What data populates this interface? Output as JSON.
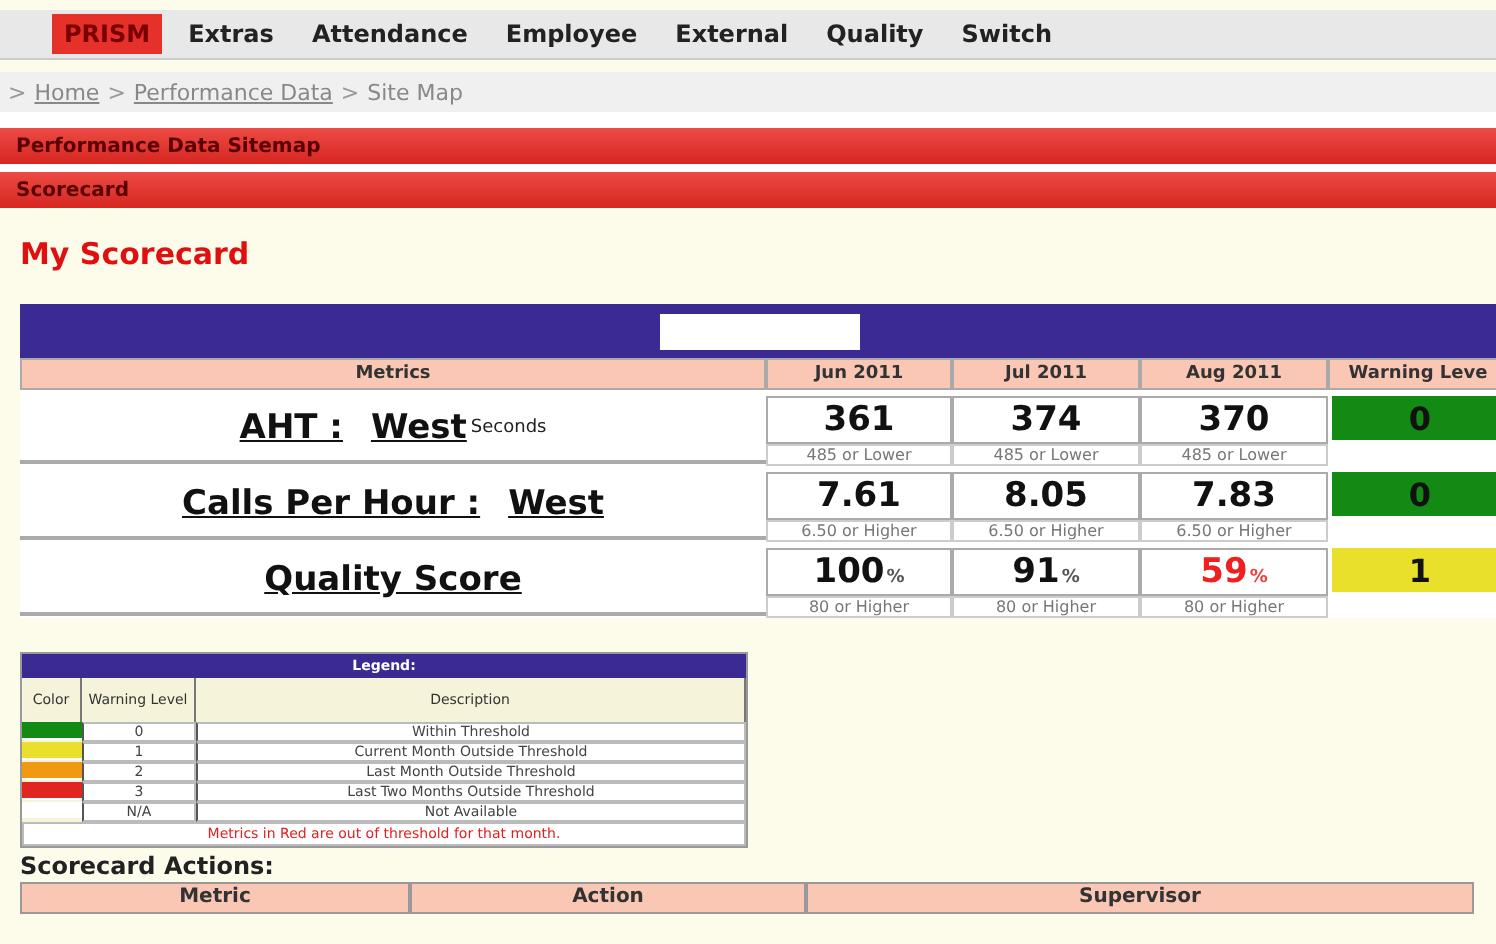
{
  "menu": [
    {
      "label": "PRISM",
      "selected": true
    },
    {
      "label": "Extras",
      "selected": false
    },
    {
      "label": "Attendance",
      "selected": false
    },
    {
      "label": "Employee",
      "selected": false
    },
    {
      "label": "External",
      "selected": false
    },
    {
      "label": "Quality",
      "selected": false
    },
    {
      "label": "Switch",
      "selected": false
    }
  ],
  "breadcrumb": [
    {
      "separator": ">",
      "label": "Home",
      "kind": "link"
    },
    {
      "separator": ">",
      "label": "Performance Data",
      "kind": "link"
    },
    {
      "separator": ">",
      "label": "Site Map",
      "kind": "text"
    }
  ],
  "section_bars": [
    "Performance Data Sitemap",
    "Scorecard"
  ],
  "page_title": "My Scorecard",
  "scorecard": {
    "columns": [
      "Metrics",
      "Jun 2011",
      "Jul 2011",
      "Aug 2011",
      "Warning Leve"
    ],
    "rows": [
      {
        "name": "AHT :",
        "region": "West",
        "unit_label": "Seconds",
        "months": [
          {
            "value": "361",
            "threshold": "485 or Lower",
            "out_of_threshold": false
          },
          {
            "value": "374",
            "threshold": "485 or Lower",
            "out_of_threshold": false
          },
          {
            "value": "370",
            "threshold": "485 or Lower",
            "out_of_threshold": false
          }
        ],
        "warning": "0",
        "color": "#138a13"
      },
      {
        "name": "Calls Per Hour :",
        "region": "West",
        "months": [
          {
            "value": "7.61",
            "threshold": "6.50 or Higher",
            "out_of_threshold": false
          },
          {
            "value": "8.05",
            "threshold": "6.50 or Higher",
            "out_of_threshold": false
          },
          {
            "value": "7.83",
            "threshold": "6.50 or Higher",
            "out_of_threshold": false
          }
        ],
        "warning": "0",
        "color": "#138a13"
      },
      {
        "name": "Quality Score",
        "months": [
          {
            "value": "100",
            "unit": "%",
            "threshold": "80 or Higher",
            "out_of_threshold": false
          },
          {
            "value": "91",
            "unit": "%",
            "threshold": "80 or Higher",
            "out_of_threshold": false
          },
          {
            "value": "59",
            "unit": "%",
            "threshold": "80 or Higher",
            "out_of_threshold": true
          }
        ],
        "warning": "1",
        "color": "#e8e02a"
      }
    ]
  },
  "legend": {
    "title": "Legend:",
    "columns": [
      "Color",
      "Warning Level",
      "Description"
    ],
    "rows": [
      {
        "color": "#138a13",
        "level": "0",
        "description": "Within Threshold"
      },
      {
        "color": "#e8e02a",
        "level": "1",
        "description": "Current Month Outside Threshold"
      },
      {
        "color": "#f09a12",
        "level": "2",
        "description": "Last Month Outside Threshold"
      },
      {
        "color": "#e0261e",
        "level": "3",
        "description": "Last Two Months Outside Threshold"
      },
      {
        "level": "N/A",
        "description": "Not Available"
      }
    ],
    "note": "Metrics in Red are out of threshold for that month."
  },
  "actions": {
    "title": "Scorecard Actions:",
    "columns": [
      "Metric",
      "Action",
      "Supervisor"
    ]
  }
}
